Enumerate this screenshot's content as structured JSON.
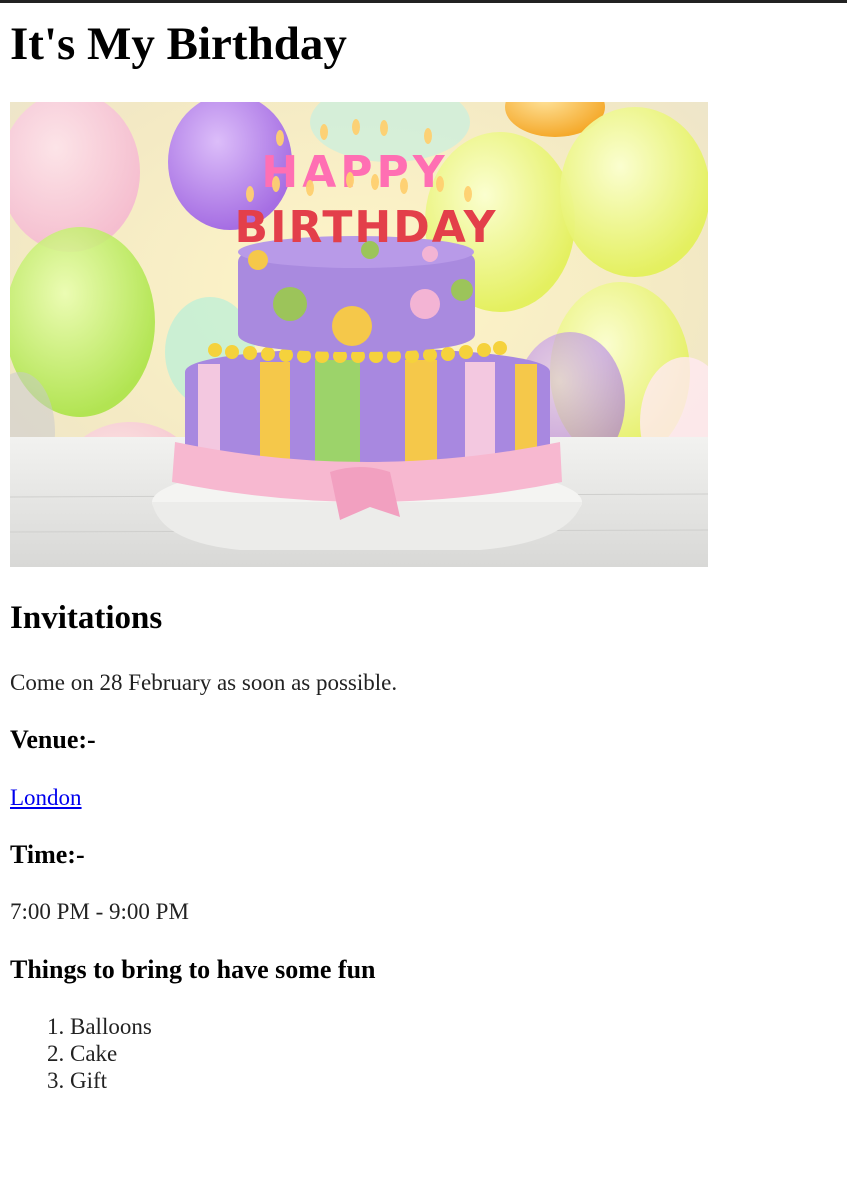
{
  "page": {
    "title": "It's My Birthday",
    "image_alt": "birthday-cake-image",
    "cake_topper": [
      "HAPPY",
      "BIRTHDAY"
    ]
  },
  "invitations": {
    "heading": "Invitations",
    "message": "Come on 28 February as soon as possible.",
    "venue_heading": "Venue:-",
    "venue_link": "London",
    "time_heading": "Time:-",
    "time_value": "7:00 PM - 9:00 PM",
    "things_heading": "Things to bring to have some fun",
    "things": [
      "Balloons",
      "Cake",
      "Gift"
    ]
  },
  "colors": {
    "text": "#222222",
    "heading": "#000000",
    "link": "#0000ee",
    "background": "#ffffff"
  }
}
